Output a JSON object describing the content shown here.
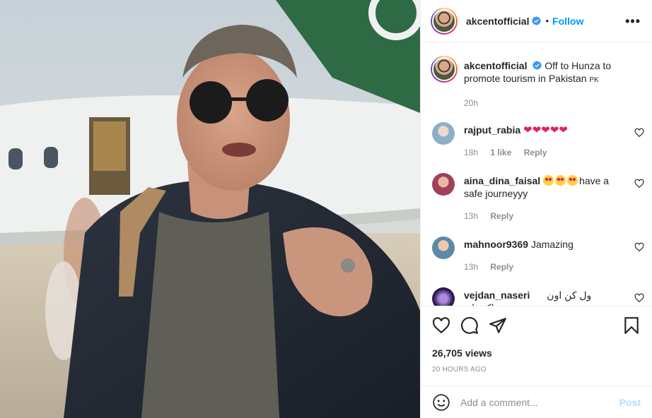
{
  "header": {
    "username": "akcentofficial",
    "dot": "•",
    "follow_label": "Follow",
    "more_label": "•••"
  },
  "caption": {
    "username": "akcentofficial",
    "text": "Off to Hunza to promote tourism in Pakistan",
    "flag_text": "PK",
    "time": "20h"
  },
  "comments": [
    {
      "username": "rajput_rabia",
      "text": "",
      "emoji": "❤❤❤❤❤",
      "time": "18h",
      "likes": "1 like",
      "reply": "Reply"
    },
    {
      "username": "aina_dina_faisal",
      "text": "have a safe journeyyy",
      "time": "13h",
      "reply": "Reply"
    },
    {
      "username": "mahnoor9369",
      "text": "Jamazing",
      "time": "13h",
      "reply": "Reply"
    },
    {
      "username": "vejdan_naseri",
      "text": "ول کن اون پاکستانو"
    }
  ],
  "stats": {
    "views": "26,705 views",
    "time_ago": "20 HOURS AGO"
  },
  "add_comment": {
    "placeholder": "Add a comment...",
    "post_label": "Post"
  },
  "icons": {
    "more": "more-options-icon",
    "verified": "verified-badge-icon",
    "like": "heart-icon",
    "comment": "comment-icon",
    "share": "paper-plane-icon",
    "save": "bookmark-icon",
    "emoji": "emoji-smile-icon"
  },
  "colors": {
    "accent": "#0095f6",
    "verified": "#3897f0",
    "muted": "#8e8e8e",
    "post_disabled": "#b2dffc",
    "heart_red": "#e0245e"
  }
}
